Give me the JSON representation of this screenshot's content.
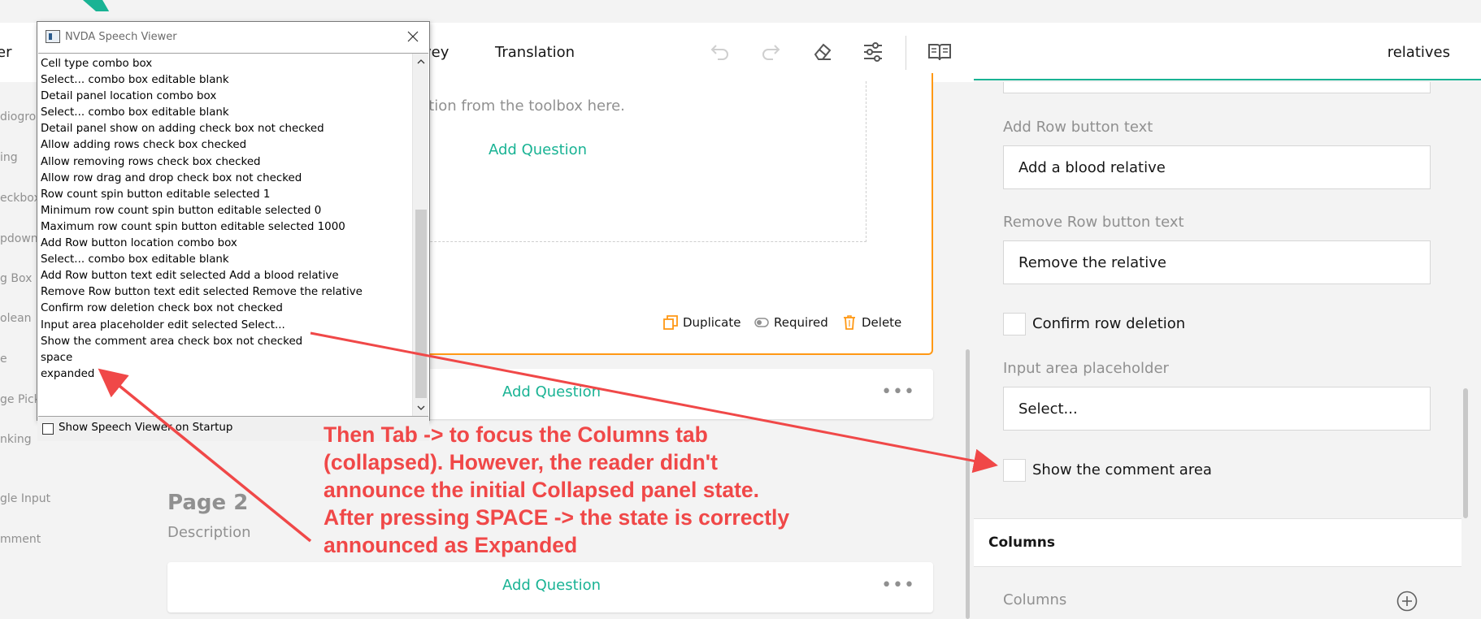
{
  "header": {
    "tabs": [
      {
        "label": "er"
      },
      {
        "label": "vey"
      },
      {
        "label": "Translation"
      }
    ],
    "icons": [
      "undo-icon",
      "redo-icon",
      "eraser-icon",
      "settings-icon",
      "book-icon"
    ],
    "right_title": "relatives"
  },
  "toolbox": {
    "items": [
      {
        "label": "diogrou"
      },
      {
        "label": "ing"
      },
      {
        "label": "eckbox"
      },
      {
        "label": "pdown"
      },
      {
        "label": "g Box"
      },
      {
        "label": "olean"
      },
      {
        "label": "e"
      },
      {
        "label": "ge Pick"
      },
      {
        "label": "nking"
      },
      {
        "label": "gle Input"
      },
      {
        "label": "mment"
      }
    ]
  },
  "canvas": {
    "drop_hint": "p a question from the toolbox here.",
    "add_question": "Add Question",
    "actions": {
      "duplicate": "Duplicate",
      "required": "Required",
      "delete": "Delete"
    },
    "more": "•••",
    "page2": {
      "title": "Page 2",
      "description": "Description"
    }
  },
  "properties": {
    "add_row_label": "Add Row button text",
    "add_row_value": "Add a blood relative",
    "remove_row_label": "Remove Row button text",
    "remove_row_value": "Remove the relative",
    "confirm_deletion": "Confirm row deletion",
    "input_placeholder_label": "Input area placeholder",
    "input_placeholder_value": "Select...",
    "show_comment": "Show the comment area",
    "columns_section": "Columns",
    "columns_label": "Columns"
  },
  "nvda": {
    "title": "NVDA Speech Viewer",
    "lines": [
      "Cell type  combo box",
      "Select...  combo box  editable  blank",
      "Detail panel location  combo box",
      "Select...  combo box  editable  blank",
      "Detail panel show on adding  check box  not checked",
      "Allow adding rows  check box  checked",
      "Allow removing rows  check box  checked",
      "Allow row drag and drop  check box  not checked",
      "Row count  spin button  editable  selected 1",
      "Minimum row count  spin button  editable  selected 0",
      "Maximum row count  spin button  editable  selected 1000",
      "Add Row button location  combo box",
      "Select...  combo box  editable  blank",
      "Add Row button text  edit  selected Add a blood relative",
      "Remove Row button text  edit  selected Remove the relative",
      "Confirm row deletion  check box  not checked",
      "Input area placeholder  edit  selected Select...",
      "Show the comment area  check box  not checked",
      "space",
      "expanded"
    ],
    "show_on_startup": "Show Speech Viewer on Startup"
  },
  "annotation": {
    "lines": [
      "Then Tab -> to focus the Columns tab",
      "(collapsed). However, the reader didn't",
      "announce the initial Collapsed panel state.",
      "After pressing SPACE -> the state is correctly",
      "announced as Expanded"
    ]
  },
  "colors": {
    "accent": "#19b394",
    "selected_border": "#ff9814",
    "annotation": "#f04848"
  }
}
